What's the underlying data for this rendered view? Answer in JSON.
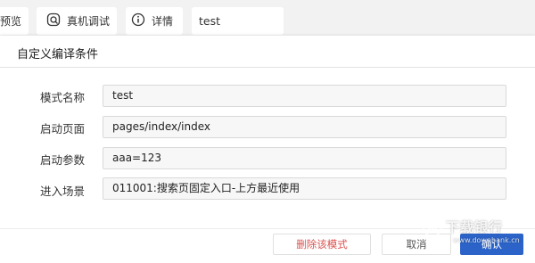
{
  "toolbar": {
    "preview_label": "预览",
    "debug_label": "真机调试",
    "details_label": "详情",
    "mode_value": "test",
    "debug_icon": "search-icon",
    "details_icon": "info-icon"
  },
  "dialog": {
    "title": "自定义编译条件",
    "fields": [
      {
        "label": "模式名称",
        "value": "test"
      },
      {
        "label": "启动页面",
        "value": "pages/index/index"
      },
      {
        "label": "启动参数",
        "value": "aaa=123"
      },
      {
        "label": "进入场景",
        "value": "011001:搜索页固定入口-上方最近使用"
      }
    ],
    "delete_label": "删除该模式",
    "cancel_label": "取消",
    "ok_label": "确认"
  },
  "watermark": {
    "title": "下载银行",
    "site": "www.downbank.cn"
  },
  "colors": {
    "primary_button": "#2b63c8",
    "danger_text": "#d9534f"
  }
}
